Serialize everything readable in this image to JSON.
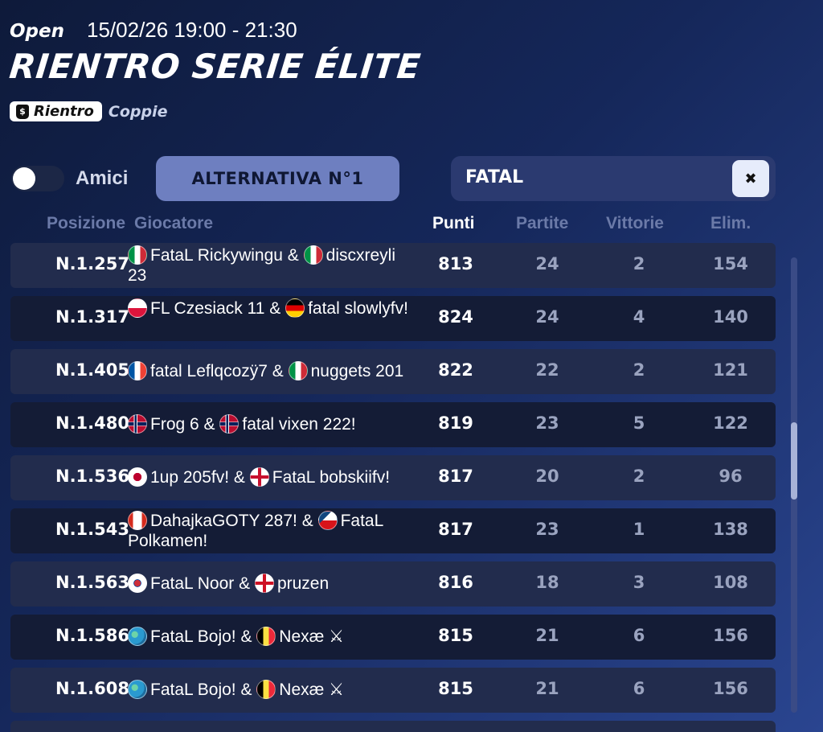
{
  "header": {
    "mode": "Open",
    "datetime": "15/02/26 19:00 - 21:30",
    "title": "RIENTRO SERIE ÉLITE",
    "tag_label": "Rientro",
    "tag_icon": "money-bag-icon",
    "team_type": "Coppie"
  },
  "filters": {
    "friends_label": "Amici",
    "friends_toggle_on": false,
    "alternate_label": "ALTERNATIVA N°1",
    "search_value": "FATAL",
    "clear_icon": "close-icon"
  },
  "columns": {
    "position": "Posizione",
    "player": "Giocatore",
    "points": "Punti",
    "matches": "Partite",
    "wins": "Vittorie",
    "elims": "Elim."
  },
  "rows": [
    {
      "position": "N.1.257",
      "players": "FataL Rickywingu & ",
      "players2": "discxreyli 23",
      "flag1": "italy",
      "flag2": "italy",
      "points": "813",
      "matches": "24",
      "wins": "2",
      "elims": "154"
    },
    {
      "position": "N.1.317",
      "players": "FL Czesiack 11 & ",
      "players2": "fatal slowlyfv!",
      "flag1": "poland",
      "flag2": "germany",
      "points": "824",
      "matches": "24",
      "wins": "4",
      "elims": "140"
    },
    {
      "position": "N.1.405",
      "players": "fatal Leflqcozÿ7 & ",
      "players2": "nuggets 201",
      "flag1": "france",
      "flag2": "italy",
      "points": "822",
      "matches": "22",
      "wins": "2",
      "elims": "121"
    },
    {
      "position": "N.1.480",
      "players": "Frog 6 & ",
      "players2": "fatal vixen 222!",
      "flag1": "norway",
      "flag2": "norway",
      "points": "819",
      "matches": "23",
      "wins": "5",
      "elims": "122"
    },
    {
      "position": "N.1.536",
      "players": "1up 205fv! & ",
      "players2": "FataL bobskiifv!",
      "flag1": "japan",
      "flag2": "uk",
      "points": "817",
      "matches": "20",
      "wins": "2",
      "elims": "96"
    },
    {
      "position": "N.1.543",
      "players": "DahajkaGOTY 287! & ",
      "players2": "FataL Polkamen!",
      "flag1": "canada",
      "flag2": "czech",
      "points": "817",
      "matches": "23",
      "wins": "1",
      "elims": "138"
    },
    {
      "position": "N.1.563",
      "players": "FataL Noor & ",
      "players2": "pruzen",
      "flag1": "korea",
      "flag2": "england",
      "points": "816",
      "matches": "18",
      "wins": "3",
      "elims": "108"
    },
    {
      "position": "N.1.586",
      "players": "FataL Bojo! & ",
      "players2": "Nexæ ⚔",
      "flag1": "globe",
      "flag2": "belgium",
      "points": "815",
      "matches": "21",
      "wins": "6",
      "elims": "156"
    },
    {
      "position": "N.1.608",
      "players": "FataL Bojo! & ",
      "players2": "Nexæ ⚔",
      "flag1": "globe",
      "flag2": "belgium",
      "points": "815",
      "matches": "21",
      "wins": "6",
      "elims": "156"
    }
  ],
  "colors": {
    "accent_button": "#6e7fc0",
    "row_light": "#222c4d",
    "row_dark": "#141c36",
    "muted_text": "#9aa3bf"
  }
}
